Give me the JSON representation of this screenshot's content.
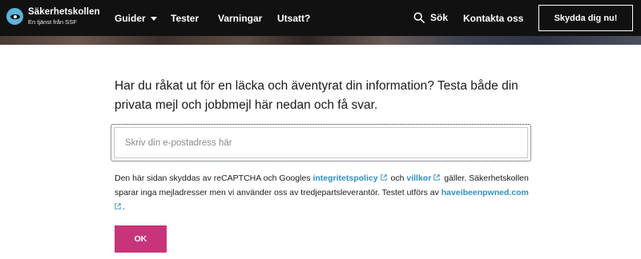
{
  "header": {
    "brand_name": "Säkerhetskollen",
    "brand_sub": "En tjänst från SSF",
    "nav": {
      "guider": "Guider",
      "tester": "Tester",
      "varningar": "Varningar",
      "utsatt": "Utsatt?",
      "sok": "Sök",
      "kontakta": "Kontakta oss"
    },
    "cta": "Skydda dig nu!"
  },
  "main": {
    "heading": "Har du råkat ut för en läcka och äventyrat din information? Testa både din privata mejl och jobbmejl här nedan och få svar.",
    "email_placeholder": "Skriv din e-postadress här",
    "email_value": "",
    "info": {
      "part1": "Den här sidan skyddas av reCAPTCHA och Googles",
      "link_privacy": "integritetspolicy",
      "part2": "och",
      "link_terms": "villkor",
      "part3": "gäller. Säkerhetskollen sparar inga mejladresser men vi använder oss av tredjepartsleverantör. Testet utförs av",
      "link_hibp": "haveibeenpwned.com",
      "part4": "."
    },
    "ok_label": "OK"
  },
  "colors": {
    "topbar": "#111111",
    "brand_blue": "#5ab4dc",
    "link": "#2f8fc6",
    "ok_button": "#c8347a"
  },
  "icons": [
    "eye-logo-icon",
    "caret-down-icon",
    "search-icon",
    "external-link-icon"
  ]
}
